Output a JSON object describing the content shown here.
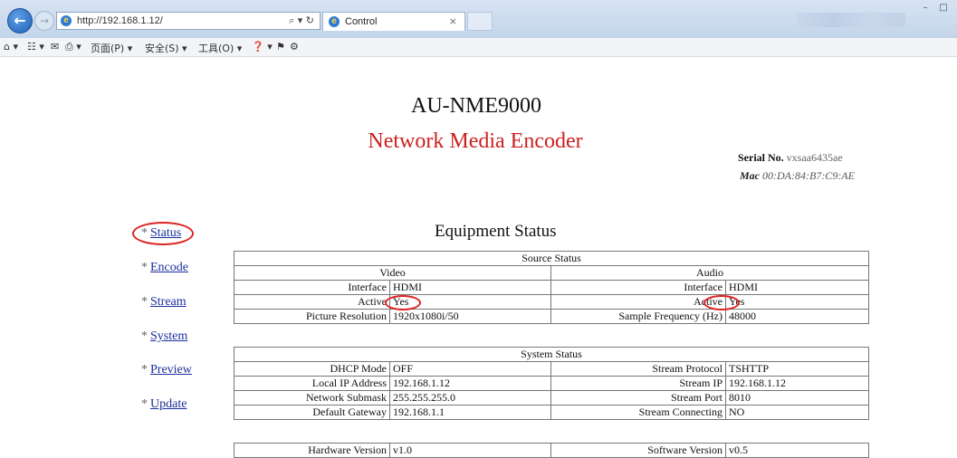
{
  "browser": {
    "url": "http://192.168.1.12/",
    "address_tools": "⌕ ▾ ↻",
    "tab_title": "Control",
    "tab_close": "×",
    "cmdbar": [
      "⌂ ▾",
      "☷ ▾",
      "✉",
      "⎙ ▾",
      "页面(P) ▾",
      "安全(S) ▾",
      "工具(O) ▾",
      "❓ ▾",
      "⚑",
      "⚙"
    ]
  },
  "header": {
    "model": "AU-NME9000",
    "subtitle": "Network Media Encoder",
    "serial_label": "Serial No.",
    "serial_value": "vxsaa6435ae",
    "mac_label": "Mac",
    "mac_value": "00:DA:84:B7:C9:AE"
  },
  "page_title": "Equipment Status",
  "nav": [
    {
      "label": "Status"
    },
    {
      "label": "Encode"
    },
    {
      "label": "Stream"
    },
    {
      "label": "System"
    },
    {
      "label": "Preview"
    },
    {
      "label": "Update"
    }
  ],
  "source_status": {
    "title": "Source Status",
    "video_header": "Video",
    "audio_header": "Audio",
    "rows": [
      {
        "vl": "Interface",
        "vv": "HDMI",
        "al": "Interface",
        "av": "HDMI"
      },
      {
        "vl": "Active",
        "vv": "Yes",
        "al": "Active",
        "av": "Yes"
      },
      {
        "vl": "Picture Resolution",
        "vv": "1920x1080i/50",
        "al": "Sample Frequency (Hz)",
        "av": "48000"
      }
    ]
  },
  "system_status": {
    "title": "System Status",
    "rows": [
      {
        "l1": "DHCP Mode",
        "v1": "OFF",
        "l2": "Stream Protocol",
        "v2": "TSHTTP"
      },
      {
        "l1": "Local IP Address",
        "v1": "192.168.1.12",
        "l2": "Stream IP",
        "v2": "192.168.1.12"
      },
      {
        "l1": "Network Submask",
        "v1": "255.255.255.0",
        "l2": "Stream Port",
        "v2": "8010"
      },
      {
        "l1": "Default Gateway",
        "v1": "192.168.1.1",
        "l2": "Stream Connecting",
        "v2": "NO"
      }
    ]
  },
  "versions": {
    "hw_label": "Hardware Version",
    "hw_value": "v1.0",
    "sw_label": "Software Version",
    "sw_value": "v0.5"
  }
}
